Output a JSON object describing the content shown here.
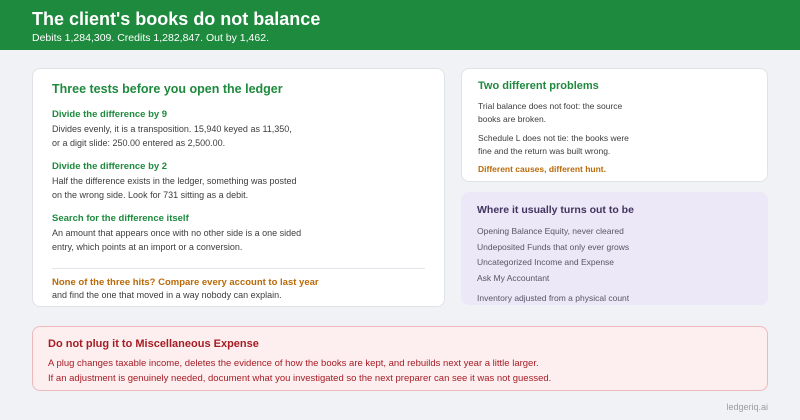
{
  "header": {
    "title": "The client's books do not balance",
    "subtitle": "Debits 1,284,309. Credits 1,282,847. Out by 1,462."
  },
  "tests": {
    "heading": "Three tests before you open the ledger",
    "items": [
      {
        "title": "Divide the difference by 9",
        "line1": "Divides evenly, it is a transposition. 15,940 keyed as 11,350,",
        "line2": "or a digit slide: 250.00 entered as 2,500.00."
      },
      {
        "title": "Divide the difference by 2",
        "line1": "Half the difference exists in the ledger, something was posted",
        "line2": "on the wrong side. Look for 731 sitting as a debit."
      },
      {
        "title": "Search for the difference itself",
        "line1": "An amount that appears once with no other side is a one sided",
        "line2": "entry, which points at an import or a conversion."
      }
    ],
    "fallback_title": "None of the three hits? Compare every account to last year",
    "fallback_text": "and find the one that moved in a way nobody can explain."
  },
  "problems": {
    "heading": "Two different problems",
    "p1_line1": "Trial balance does not foot: the source",
    "p1_line2": "books are broken.",
    "p2_line1": "Schedule L does not tie: the books were",
    "p2_line2": "fine and the return was built wrong.",
    "emphasis": "Different causes, different hunt."
  },
  "where": {
    "heading": "Where it usually turns out to be",
    "items": [
      "Opening Balance Equity, never cleared",
      "Undeposited Funds that only ever grows",
      "Uncategorized Income and Expense",
      "Ask My Accountant"
    ],
    "last": "Inventory adjusted from a physical count"
  },
  "warning": {
    "heading": "Do not plug it to Miscellaneous Expense",
    "line1": "A plug changes taxable income, deletes the evidence of how the books are kept, and rebuilds next year a little larger.",
    "line2": "If an adjustment is genuinely needed, document what you investigated so the next preparer can see it was not guessed."
  },
  "footer": {
    "brand": "ledgeriq.ai"
  },
  "colors": {
    "header_bg": "#1e8a3e",
    "accent_green": "#1e8a3e",
    "accent_orange": "#b86a08",
    "warn_red": "#a51c24",
    "where_bg": "#ece8f7"
  }
}
